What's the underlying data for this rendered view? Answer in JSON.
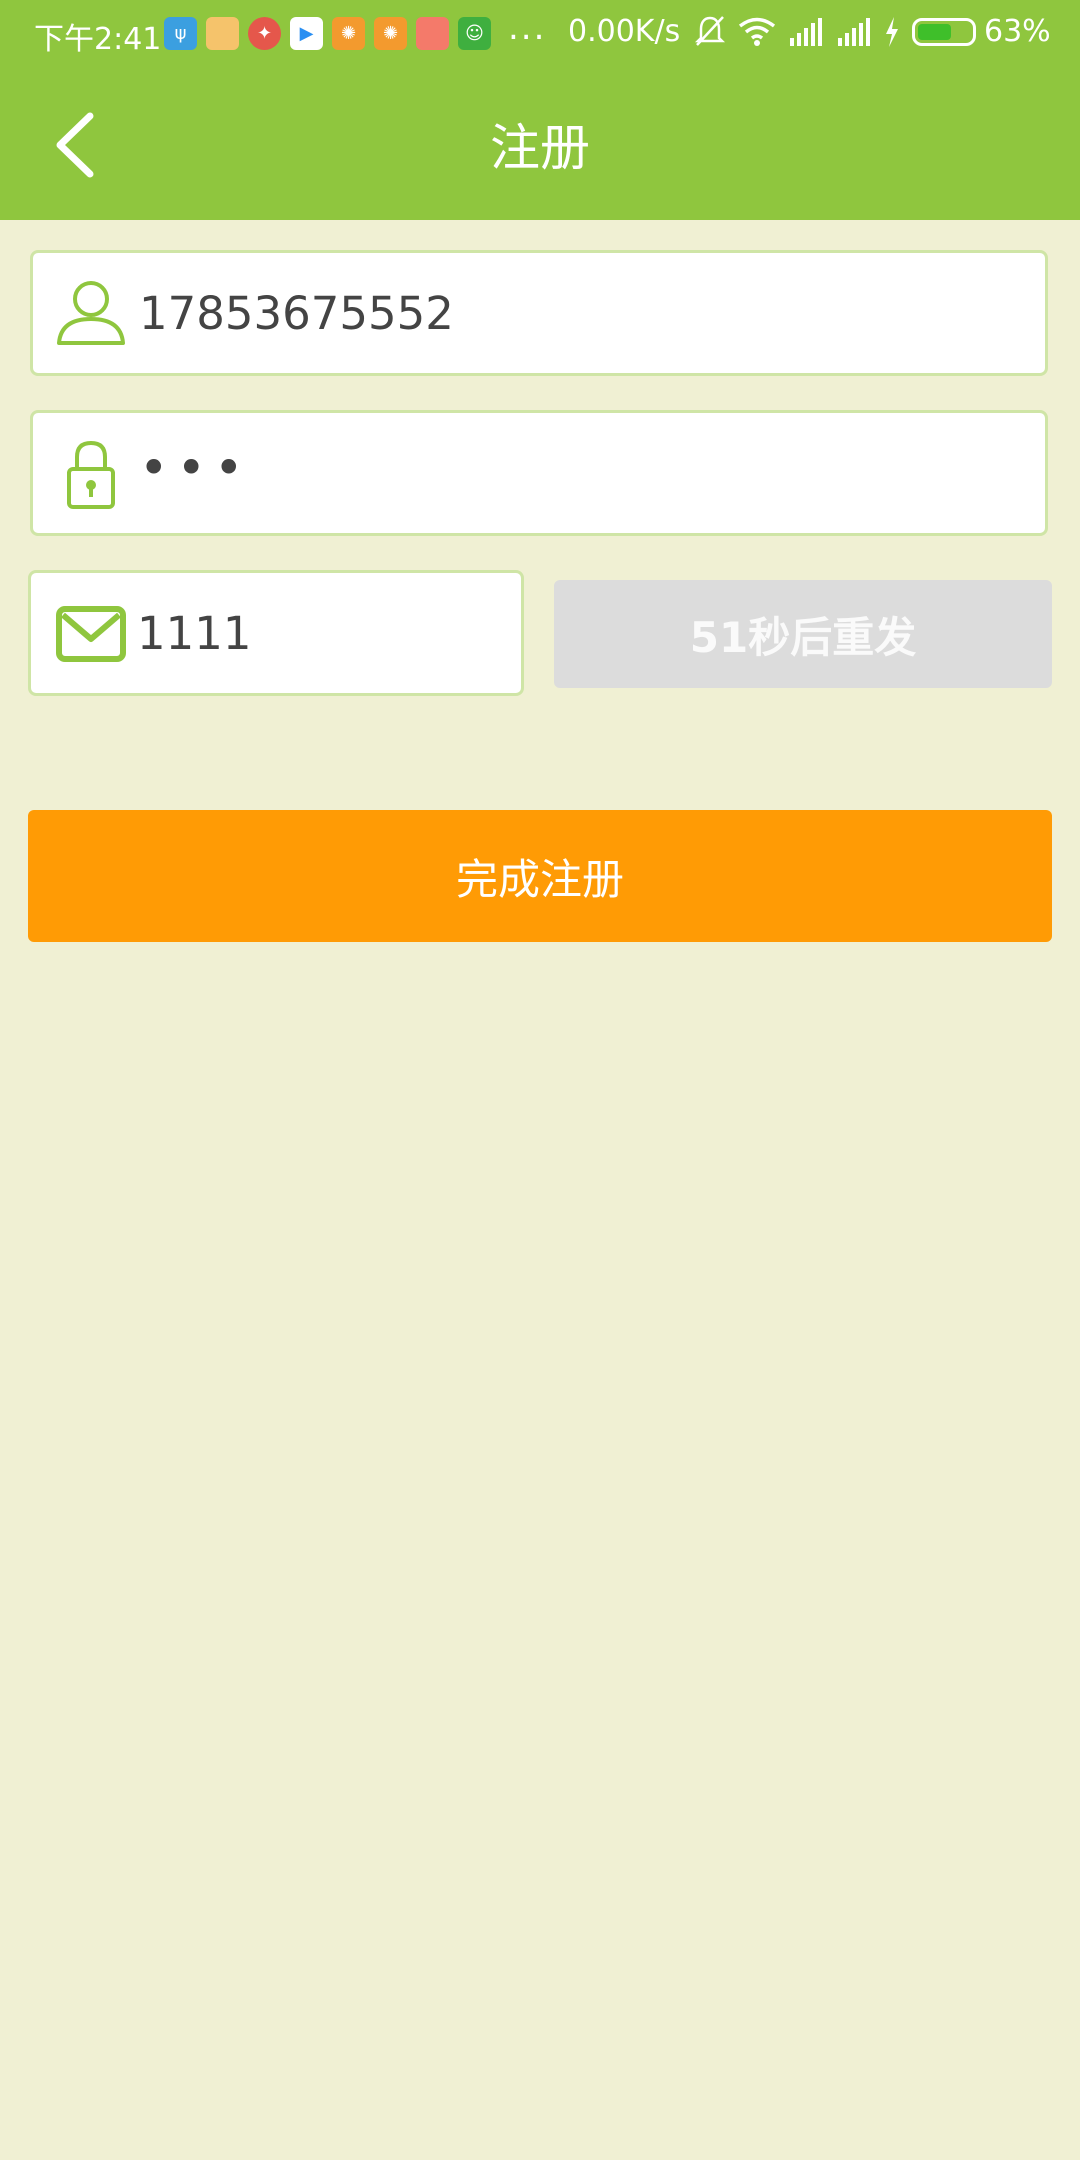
{
  "status_bar": {
    "time": "下午2:41",
    "more": "...",
    "net_speed": "0.00K/s",
    "battery_pct": "63%",
    "battery_level": 0.63
  },
  "header": {
    "title": "注册",
    "bg_color": "#8fc63e"
  },
  "form": {
    "phone_value": "17853675552",
    "password_value": "•••",
    "code_value": "1111",
    "resend_label": "51秒后重发",
    "submit_label": "完成注册"
  },
  "colors": {
    "page_bg": "#f0f0d3",
    "accent_green": "#8fc63e",
    "submit_orange": "#ff9b05",
    "resend_disabled": "#dcdcdc"
  }
}
